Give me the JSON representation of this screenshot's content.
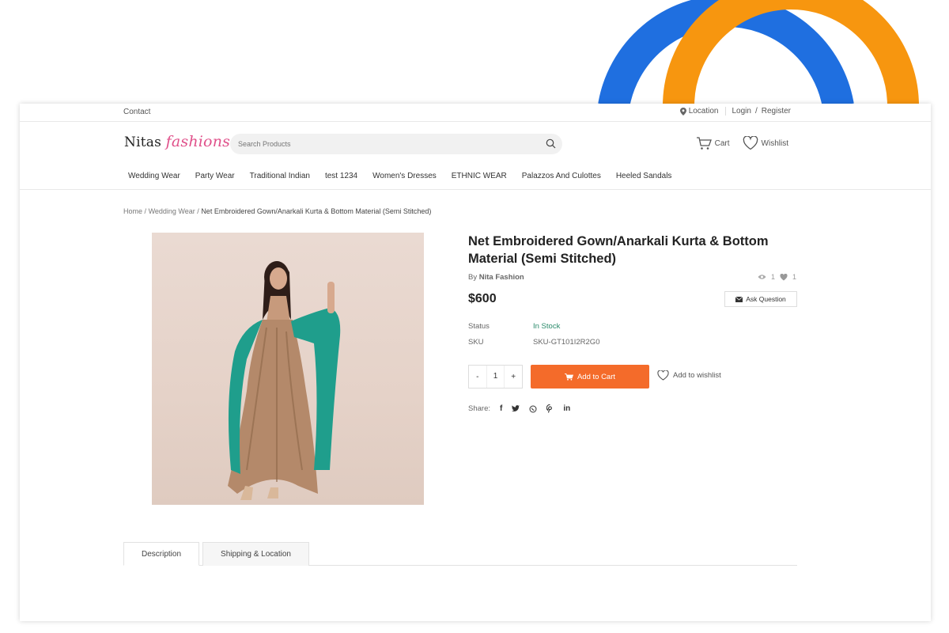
{
  "topbar": {
    "contact": "Contact",
    "location": "Location",
    "login": "Login",
    "separator": "/",
    "register": "Register"
  },
  "header": {
    "logo_a": "Nitas",
    "logo_b": "fashions",
    "search_placeholder": "Search Products",
    "cart": "Cart",
    "wishlist": "Wishlist"
  },
  "nav": {
    "items": [
      {
        "label": "Wedding Wear"
      },
      {
        "label": "Party Wear"
      },
      {
        "label": "Traditional Indian"
      },
      {
        "label": "test 1234"
      },
      {
        "label": "Women's Dresses"
      },
      {
        "label": "ETHNIC WEAR"
      },
      {
        "label": "Palazzos And Culottes"
      },
      {
        "label": "Heeled Sandals"
      }
    ]
  },
  "breadcrumb": {
    "home": "Home",
    "sep": "/",
    "category": "Wedding Wear",
    "current": "Net Embroidered Gown/Anarkali Kurta & Bottom Material (Semi Stitched)"
  },
  "product": {
    "title": "Net Embroidered Gown/Anarkali Kurta & Bottom Material (Semi Stitched)",
    "by_label": "By",
    "brand": "Nita Fashion",
    "views": "1",
    "likes": "1",
    "price": "$600",
    "ask_question": "Ask Question",
    "status_label": "Status",
    "status_value": "In Stock",
    "sku_label": "SKU",
    "sku_value": "SKU-GT101I2R2G0",
    "qty_minus": "-",
    "qty_value": "1",
    "qty_plus": "+",
    "add_to_cart": "Add to Cart",
    "add_to_wishlist": "Add to wishlist",
    "share_label": "Share:"
  },
  "tabs": [
    {
      "label": "Description"
    },
    {
      "label": "Shipping & Location"
    }
  ],
  "colors": {
    "accent_orange": "#f46b2a",
    "logo_pink": "#e0508a",
    "in_stock_green": "#2a8a6a",
    "deco_blue": "#1f6fe0",
    "deco_orange": "#f7960f"
  }
}
